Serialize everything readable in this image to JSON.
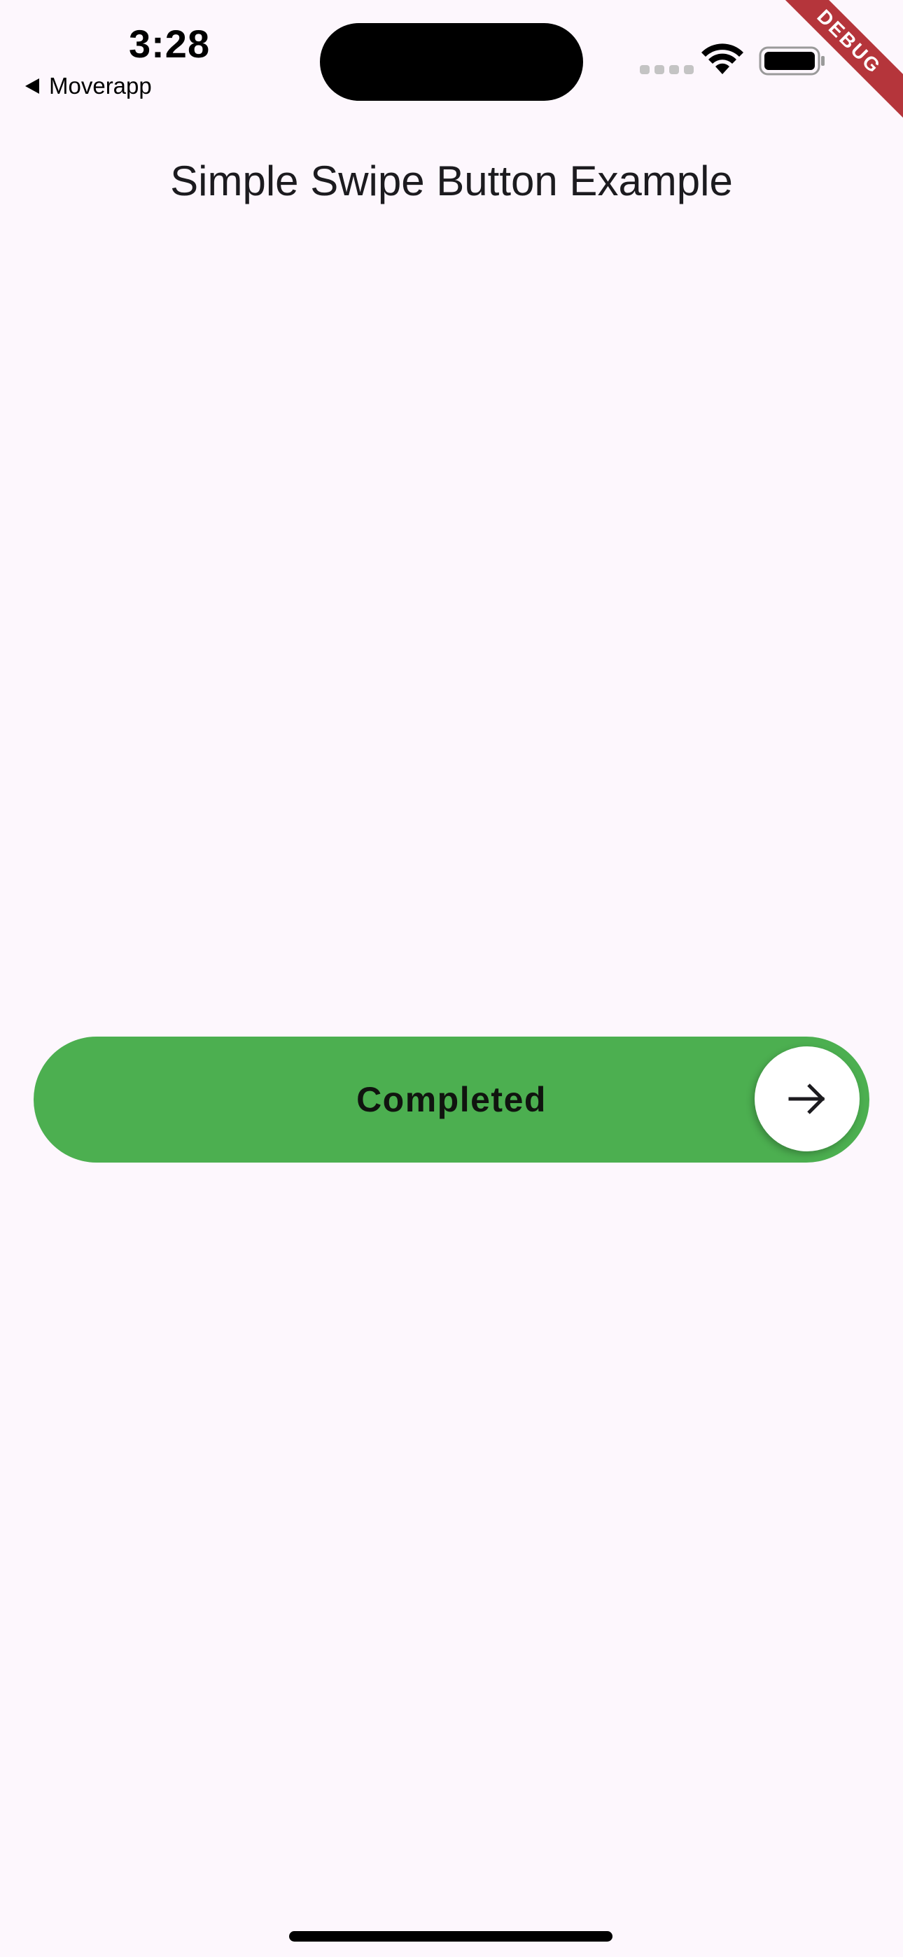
{
  "status_bar": {
    "time": "3:28",
    "back_app": "Moverapp",
    "wifi_icon": "wifi-icon",
    "battery_icon": "battery-full-icon",
    "signal_icon": "cellular-signal-icon"
  },
  "debug_banner": {
    "label": "DEBUG",
    "color": "#b5353b"
  },
  "app_bar": {
    "title": "Simple Swipe Button Example"
  },
  "swipe_button": {
    "label": "Completed",
    "track_color": "#4caf50",
    "thumb_color": "#ffffff",
    "thumb_icon": "arrow-right-icon"
  },
  "colors": {
    "background": "#fdf7fd",
    "title_text": "#1c1b1f"
  }
}
